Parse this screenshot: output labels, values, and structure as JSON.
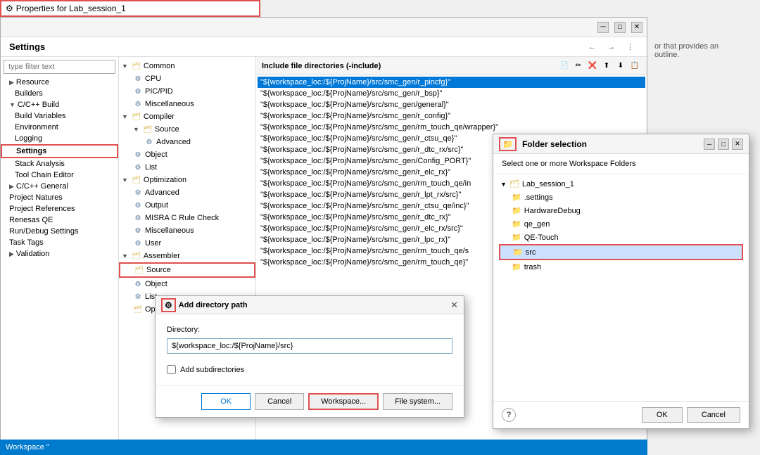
{
  "titleBar": {
    "text": "Properties for Lab_session_1",
    "icon": "⚙"
  },
  "mainWindow": {
    "title": "Settings",
    "navButtons": [
      "←",
      "→",
      "⋮"
    ]
  },
  "sidebar": {
    "filterPlaceholder": "type filter text",
    "items": [
      {
        "id": "resource",
        "label": "Resource",
        "level": 0,
        "hasArrow": true
      },
      {
        "id": "builders",
        "label": "Builders",
        "level": 1
      },
      {
        "id": "cpp-build",
        "label": "C/C++ Build",
        "level": 0,
        "hasArrow": true,
        "expanded": true
      },
      {
        "id": "build-variables",
        "label": "Build Variables",
        "level": 1
      },
      {
        "id": "environment",
        "label": "Environment",
        "level": 1
      },
      {
        "id": "logging",
        "label": "Logging",
        "level": 1
      },
      {
        "id": "settings",
        "label": "Settings",
        "level": 1,
        "highlighted": true
      },
      {
        "id": "stack-analysis",
        "label": "Stack Analysis",
        "level": 1
      },
      {
        "id": "tool-chain-editor",
        "label": "Tool Chain Editor",
        "level": 1
      },
      {
        "id": "cpp-general",
        "label": "C/C++ General",
        "level": 0,
        "hasArrow": true
      },
      {
        "id": "project-natures",
        "label": "Project Natures",
        "level": 0
      },
      {
        "id": "project-references",
        "label": "Project References",
        "level": 0
      },
      {
        "id": "renesas-qe",
        "label": "Renesas QE",
        "level": 0
      },
      {
        "id": "run-debug",
        "label": "Run/Debug Settings",
        "level": 0
      },
      {
        "id": "task-tags",
        "label": "Task Tags",
        "level": 0
      },
      {
        "id": "validation",
        "label": "Validation",
        "level": 0,
        "hasArrow": true
      }
    ]
  },
  "treePanel": {
    "items": [
      {
        "id": "common",
        "label": "Common",
        "level": 0,
        "expanded": true,
        "icon": "folder"
      },
      {
        "id": "cpu",
        "label": "CPU",
        "level": 1,
        "icon": "gear"
      },
      {
        "id": "pic-pid",
        "label": "PIC/PID",
        "level": 1,
        "icon": "gear"
      },
      {
        "id": "miscellaneous",
        "label": "Miscellaneous",
        "level": 1,
        "icon": "gear"
      },
      {
        "id": "compiler",
        "label": "Compiler",
        "level": 0,
        "expanded": true,
        "icon": "folder"
      },
      {
        "id": "compiler-source",
        "label": "Source",
        "level": 1,
        "expanded": true,
        "icon": "folder"
      },
      {
        "id": "compiler-advanced",
        "label": "Advanced",
        "level": 2,
        "icon": "gear"
      },
      {
        "id": "compiler-object",
        "label": "Object",
        "level": 1,
        "icon": "gear"
      },
      {
        "id": "compiler-list",
        "label": "List",
        "level": 1,
        "icon": "gear"
      },
      {
        "id": "optimization",
        "label": "Optimization",
        "level": 0,
        "expanded": true,
        "icon": "folder"
      },
      {
        "id": "opt-advanced",
        "label": "Advanced",
        "level": 1,
        "icon": "gear"
      },
      {
        "id": "output",
        "label": "Output",
        "level": 1,
        "icon": "gear"
      },
      {
        "id": "misra",
        "label": "MISRA C Rule Check",
        "level": 1,
        "icon": "gear"
      },
      {
        "id": "misc2",
        "label": "Miscellaneous",
        "level": 1,
        "icon": "gear"
      },
      {
        "id": "user",
        "label": "User",
        "level": 1,
        "icon": "gear"
      },
      {
        "id": "assembler",
        "label": "Assembler",
        "level": 0,
        "expanded": true,
        "icon": "folder"
      },
      {
        "id": "asm-source",
        "label": "Source",
        "level": 1,
        "icon": "folder",
        "highlighted": true
      },
      {
        "id": "asm-object",
        "label": "Object",
        "level": 1,
        "icon": "gear"
      },
      {
        "id": "asm-list",
        "label": "List",
        "level": 1,
        "icon": "gear"
      },
      {
        "id": "asm-opt",
        "label": "Optimization",
        "level": 1,
        "icon": "folder"
      }
    ]
  },
  "includePanel": {
    "header": "Include file directories (-include)",
    "items": [
      {
        "id": 1,
        "text": "\"${workspace_loc:/${ProjName}/src/smc_gen/r_pincfg}\"",
        "selected": true
      },
      {
        "id": 2,
        "text": "\"${workspace_loc:/${ProjName}/src/smc_gen/r_bsp}\""
      },
      {
        "id": 3,
        "text": "\"${workspace_loc:/${ProjName}/src/smc_gen/general}\""
      },
      {
        "id": 4,
        "text": "\"${workspace_loc:/${ProjName}/src/smc_gen/r_config}\""
      },
      {
        "id": 5,
        "text": "\"${workspace_loc:/${ProjName}/src/smc_gen/rm_touch_qe/wrapper}\""
      },
      {
        "id": 6,
        "text": "\"${workspace_loc:/${ProjName}/src/smc_gen/r_ctsu_qe}\""
      },
      {
        "id": 7,
        "text": "\"${workspace_loc:/${ProjName}/src/smc_gen/r_dtc_rx/src}\""
      },
      {
        "id": 8,
        "text": "\"${workspace_loc:/${ProjName}/src/smc_gen/Config_PORT}\""
      },
      {
        "id": 9,
        "text": "\"${workspace_loc:/${ProjName}/src/smc_gen/r_elc_rx}\""
      },
      {
        "id": 10,
        "text": "\"${workspace_loc:/${ProjName}/src/smc_gen/rm_touch_qe/in"
      },
      {
        "id": 11,
        "text": "\"${workspace_loc:/${ProjName}/src/smc_gen/r_lpt_rx/src}\""
      },
      {
        "id": 12,
        "text": "\"${workspace_loc:/${ProjName}/src/smc_gen/r_ctsu_qe/inc}\""
      },
      {
        "id": 13,
        "text": "\"${workspace_loc:/${ProjName}/src/smc_gen/r_dtc_rx}\""
      },
      {
        "id": 14,
        "text": "\"${workspace_loc:/${ProjName}/src/smc_gen/r_elc_rx/src}\""
      },
      {
        "id": 15,
        "text": "\"${workspace_loc:/${ProjName}/src/smc_gen/r_lpc_rx}\""
      },
      {
        "id": 16,
        "text": "\"${workspace_loc:/${ProjName}/src/smc_gen/rm_touch_qe/s"
      },
      {
        "id": 17,
        "text": "\"${workspace_loc:/${ProjName}/src/smc_gen/rm_touch_qe}\""
      }
    ],
    "toolIcons": [
      "📄",
      "✏",
      "❌",
      "⬆",
      "⬇",
      "📋"
    ]
  },
  "addDirectoryDialog": {
    "title": "Add directory path",
    "icon": "⚙",
    "directoryLabel": "Directory:",
    "directoryValue": "${workspace_loc:/${ProjName}/src}",
    "checkboxLabel": "Add subdirectories",
    "buttons": {
      "ok": "OK",
      "cancel": "Cancel",
      "workspace": "Workspace...",
      "fileSystem": "File system..."
    }
  },
  "folderDialog": {
    "title": "Folder selection",
    "subtitle": "Select one or more Workspace Folders",
    "rootProject": "Lab_session_1",
    "folders": [
      {
        "id": "settings",
        "label": ".settings",
        "level": 1,
        "icon": "folder"
      },
      {
        "id": "hardwaredebug",
        "label": "HardwareDebug",
        "level": 1,
        "icon": "folder"
      },
      {
        "id": "qe-gen",
        "label": "qe_gen",
        "level": 1,
        "icon": "folder"
      },
      {
        "id": "qe-touch",
        "label": "QE-Touch",
        "level": 1,
        "icon": "folder"
      },
      {
        "id": "src",
        "label": "src",
        "level": 1,
        "icon": "folder",
        "highlighted": true
      },
      {
        "id": "trash",
        "label": "trash",
        "level": 1,
        "icon": "folder"
      }
    ],
    "buttons": {
      "ok": "OK",
      "cancel": "Cancel"
    },
    "helpIcon": "?"
  },
  "statusBar": {
    "workspaceLabel": "Workspace \""
  },
  "backgroundHint": "or that provides an outline."
}
